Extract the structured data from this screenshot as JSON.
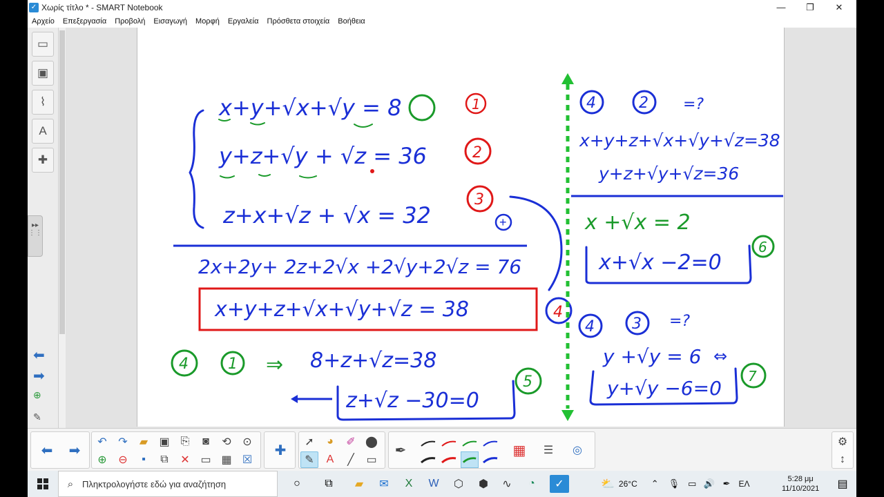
{
  "window": {
    "title": "Χωρίς τίτλο * - SMART Notebook",
    "minimize": "—",
    "maximize": "❐",
    "close": "✕"
  },
  "menu": [
    "Αρχείο",
    "Επεξεργασία",
    "Προβολή",
    "Εισαγωγή",
    "Μορφή",
    "Εργαλεία",
    "Πρόσθετα στοιχεία",
    "Βοήθεια"
  ],
  "sidebar_tabs": [
    {
      "icon": "page-sorter-icon",
      "glyph": "▭"
    },
    {
      "icon": "gallery-icon",
      "glyph": "▣"
    },
    {
      "icon": "attachments-icon",
      "glyph": "⌇"
    },
    {
      "icon": "properties-icon",
      "glyph": "A"
    },
    {
      "icon": "addons-icon",
      "glyph": "✚"
    }
  ],
  "whiteboard": {
    "left": {
      "eq1": "x+y+√x+√y = 8",
      "eq1_num": "1",
      "eq2": "y+z+√y + √z = 36",
      "eq2_num": "2",
      "eq3": "z+x+√z + √x = 32",
      "eq3_num": "3",
      "plus": "+",
      "sum_line": "2x+2y+ 2z+2√x +2√y+2√z = 76",
      "boxed": "x+y+z+√x+√y+√z = 38",
      "boxed_num": "4",
      "step": "4 , 1  ⇒  8+z+√z=38",
      "step_a": "4",
      "step_b": "1",
      "step_arrow": "⇒",
      "step_eq": "8+z+√z=38",
      "final": "z+√z −30=0",
      "final_num": "5"
    },
    "right": {
      "header_a": "4",
      "header_b": "2",
      "header_arrow": "=?",
      "line1": "x+y+z+√x+√y+√z=38",
      "line2": "y+z+√y+√z=36",
      "line3": "x +√x = 2",
      "boxed6": "x+√x −2=0",
      "num6": "6",
      "header2_a": "4",
      "header2_b": "3",
      "header2_arrow": "=?",
      "line4": "y +√y = 6",
      "equiv": "⇔",
      "boxed7": "y+√y −6=0",
      "num7": "7"
    }
  },
  "toolbar": {
    "icons": [
      "back-icon",
      "forward-icon",
      "undo-icon",
      "redo-icon",
      "open-icon",
      "screen-capture-icon",
      "paste-icon",
      "screen-shade-icon",
      "fill-icon",
      "select-icon",
      "pens-icon",
      "eraser-icon",
      "text-icon",
      "line-icon",
      "shapes-icon",
      "color-palette-icon",
      "collapse-icon"
    ]
  },
  "taskbar": {
    "search_placeholder": "Πληκτρολογήστε εδώ για αναζήτηση",
    "weather": "26°C",
    "lang": "ΕΛ",
    "time": "5:28 μμ",
    "date": "11/10/2021"
  },
  "colors": {
    "ink_blue": "#1a2fd6",
    "ink_red": "#e01818",
    "ink_green": "#1a9a2a",
    "divider_green": "#22c033"
  }
}
